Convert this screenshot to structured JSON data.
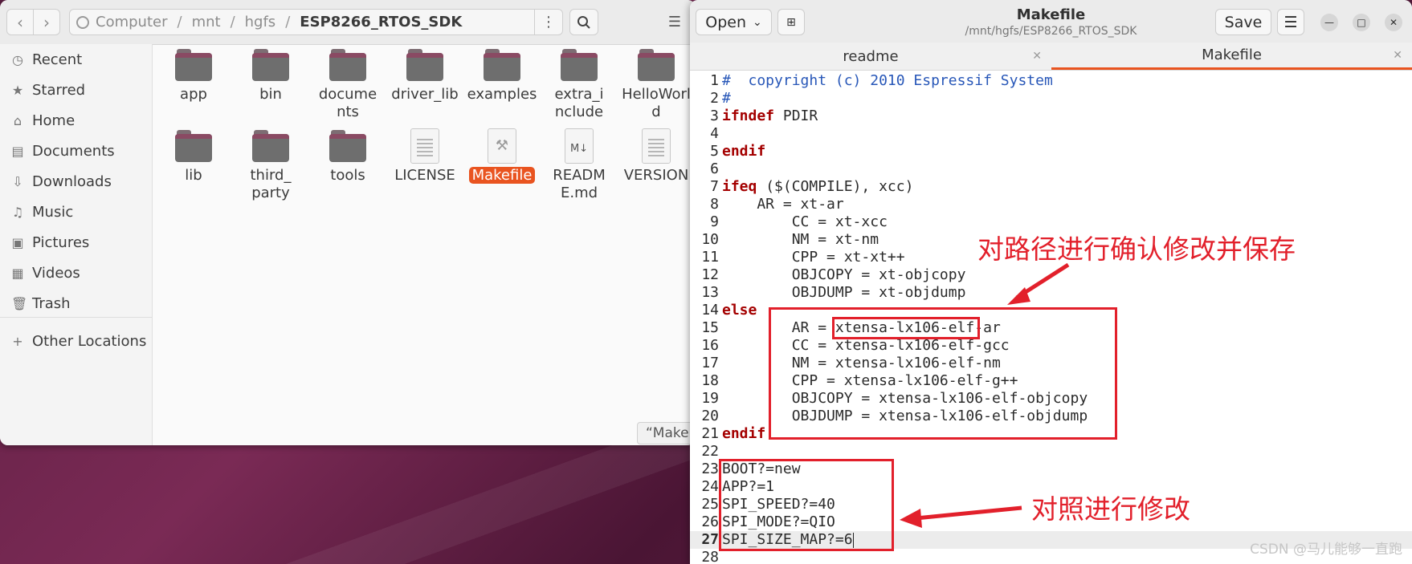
{
  "files": {
    "path": [
      "Computer",
      "mnt",
      "hgfs",
      "ESP8266_RTOS_SDK"
    ],
    "path_menu_icon": "vertical-dots-icon",
    "sidebar": [
      {
        "label": "Recent",
        "icon": "clock-icon"
      },
      {
        "label": "Starred",
        "icon": "star-icon"
      },
      {
        "label": "Home",
        "icon": "home-icon"
      },
      {
        "label": "Documents",
        "icon": "document-icon"
      },
      {
        "label": "Downloads",
        "icon": "download-icon"
      },
      {
        "label": "Music",
        "icon": "music-icon"
      },
      {
        "label": "Pictures",
        "icon": "picture-icon"
      },
      {
        "label": "Videos",
        "icon": "video-icon"
      },
      {
        "label": "Trash",
        "icon": "trash-icon"
      },
      {
        "label": "Other Locations",
        "icon": "plus-icon"
      }
    ],
    "items": [
      {
        "label": "app",
        "type": "folder"
      },
      {
        "label": "bin",
        "type": "folder"
      },
      {
        "label": "documents",
        "type": "folder"
      },
      {
        "label": "driver_lib",
        "type": "folder"
      },
      {
        "label": "examples",
        "type": "folder"
      },
      {
        "label": "extra_include",
        "type": "folder"
      },
      {
        "label": "HelloWorld",
        "type": "folder"
      },
      {
        "label": "lib",
        "type": "folder"
      },
      {
        "label": "third_party",
        "type": "folder"
      },
      {
        "label": "tools",
        "type": "folder"
      },
      {
        "label": "LICENSE",
        "type": "text"
      },
      {
        "label": "Makefile",
        "type": "makefile",
        "selected": true
      },
      {
        "label": "README.md",
        "type": "markdown"
      },
      {
        "label": "VERSION",
        "type": "text"
      }
    ],
    "status": "“Make"
  },
  "editor": {
    "open_label": "Open",
    "save_label": "Save",
    "title": "Makefile",
    "subtitle": "/mnt/hgfs/ESP8266_RTOS_SDK",
    "tabs": [
      {
        "label": "readme",
        "active": false
      },
      {
        "label": "Makefile",
        "active": true
      }
    ],
    "current_line": 27,
    "lines": [
      {
        "n": "1",
        "segments": [
          {
            "t": "#  copyright (c) 2010 Espressif System",
            "c": "cm"
          }
        ]
      },
      {
        "n": "2",
        "segments": [
          {
            "t": "#",
            "c": "cm"
          }
        ]
      },
      {
        "n": "3",
        "segments": [
          {
            "t": "ifndef",
            "c": "kw"
          },
          {
            "t": " PDIR",
            "c": ""
          }
        ]
      },
      {
        "n": "4",
        "segments": []
      },
      {
        "n": "5",
        "segments": [
          {
            "t": "endif",
            "c": "kw"
          }
        ]
      },
      {
        "n": "6",
        "segments": []
      },
      {
        "n": "7",
        "segments": [
          {
            "t": "ifeq",
            "c": "kw"
          },
          {
            "t": " ($(COMPILE), xcc)",
            "c": ""
          }
        ]
      },
      {
        "n": "8",
        "segments": [
          {
            "t": "    AR = xt-ar",
            "c": ""
          }
        ]
      },
      {
        "n": "9",
        "segments": [
          {
            "t": "        CC = xt-xcc",
            "c": ""
          }
        ]
      },
      {
        "n": "10",
        "segments": [
          {
            "t": "        NM = xt-nm",
            "c": ""
          }
        ]
      },
      {
        "n": "11",
        "segments": [
          {
            "t": "        CPP = xt-xt++",
            "c": ""
          }
        ]
      },
      {
        "n": "12",
        "segments": [
          {
            "t": "        OBJCOPY = xt-objcopy",
            "c": ""
          }
        ]
      },
      {
        "n": "13",
        "segments": [
          {
            "t": "        OBJDUMP = xt-objdump",
            "c": ""
          }
        ]
      },
      {
        "n": "14",
        "segments": [
          {
            "t": "else",
            "c": "kw"
          }
        ]
      },
      {
        "n": "15",
        "segments": [
          {
            "t": "        AR = xtensa-lx106-elf-ar",
            "c": ""
          }
        ]
      },
      {
        "n": "16",
        "segments": [
          {
            "t": "        CC = xtensa-lx106-elf-gcc",
            "c": ""
          }
        ]
      },
      {
        "n": "17",
        "segments": [
          {
            "t": "        NM = xtensa-lx106-elf-nm",
            "c": ""
          }
        ]
      },
      {
        "n": "18",
        "segments": [
          {
            "t": "        CPP = xtensa-lx106-elf-g++",
            "c": ""
          }
        ]
      },
      {
        "n": "19",
        "segments": [
          {
            "t": "        OBJCOPY = xtensa-lx106-elf-objcopy",
            "c": ""
          }
        ]
      },
      {
        "n": "20",
        "segments": [
          {
            "t": "        OBJDUMP = xtensa-lx106-elf-objdump",
            "c": ""
          }
        ]
      },
      {
        "n": "21",
        "segments": [
          {
            "t": "endif",
            "c": "kw"
          }
        ]
      },
      {
        "n": "22",
        "segments": []
      },
      {
        "n": "23",
        "segments": [
          {
            "t": "BOOT?=new",
            "c": ""
          }
        ]
      },
      {
        "n": "24",
        "segments": [
          {
            "t": "APP?=1",
            "c": ""
          }
        ]
      },
      {
        "n": "25",
        "segments": [
          {
            "t": "SPI_SPEED?=40",
            "c": ""
          }
        ]
      },
      {
        "n": "26",
        "segments": [
          {
            "t": "SPI_MODE?=QIO",
            "c": ""
          }
        ]
      },
      {
        "n": "27",
        "segments": [
          {
            "t": "SPI_SIZE_MAP?=6",
            "c": ""
          }
        ]
      },
      {
        "n": "28",
        "segments": []
      }
    ]
  },
  "annotations": {
    "text1": "对路径进行确认修改并保存",
    "text2": "对照进行修改",
    "color": "#e2202b"
  },
  "watermark": "CSDN @马儿能够一直跑",
  "colors": {
    "accent": "#e95420",
    "keyword": "#a40000",
    "comment": "#2857b8"
  }
}
